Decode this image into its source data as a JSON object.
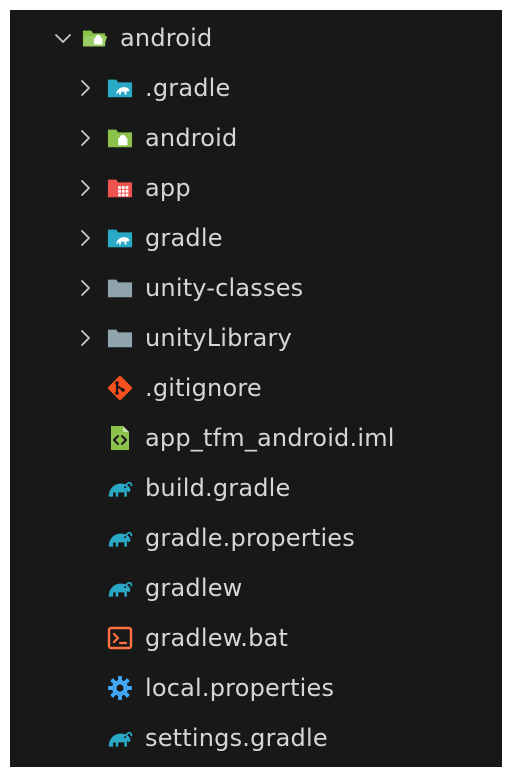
{
  "explorer": {
    "root": {
      "label": "android",
      "expanded": true,
      "icon": "android-folder-open-icon"
    },
    "items": [
      {
        "label": ".gradle",
        "type": "folder",
        "icon": "gradle-folder-icon"
      },
      {
        "label": "android",
        "type": "folder",
        "icon": "android-folder-icon"
      },
      {
        "label": "app",
        "type": "folder",
        "icon": "app-folder-icon"
      },
      {
        "label": "gradle",
        "type": "folder",
        "icon": "gradle-folder-icon"
      },
      {
        "label": "unity-classes",
        "type": "folder",
        "icon": "folder-icon"
      },
      {
        "label": "unityLibrary",
        "type": "folder",
        "icon": "folder-icon"
      },
      {
        "label": ".gitignore",
        "type": "file",
        "icon": "git-icon"
      },
      {
        "label": "app_tfm_android.iml",
        "type": "file",
        "icon": "xml-file-icon"
      },
      {
        "label": "build.gradle",
        "type": "file",
        "icon": "gradle-elephant-icon"
      },
      {
        "label": "gradle.properties",
        "type": "file",
        "icon": "gradle-elephant-icon"
      },
      {
        "label": "gradlew",
        "type": "file",
        "icon": "gradle-elephant-icon"
      },
      {
        "label": "gradlew.bat",
        "type": "file",
        "icon": "terminal-icon"
      },
      {
        "label": "local.properties",
        "type": "file",
        "icon": "settings-gear-icon"
      },
      {
        "label": "settings.gradle",
        "type": "file",
        "icon": "gradle-elephant-icon"
      }
    ]
  },
  "colors": {
    "background": "#181818",
    "text": "#d6d6d6",
    "android_green": "#8bc34a",
    "gradle_teal": "#2aa9c6",
    "app_red": "#ef5350",
    "folder_grey": "#90a4ae",
    "git_orange": "#f4511e",
    "xml_green": "#8bc34a",
    "terminal_orange": "#ff7043",
    "gear_blue": "#42a5f5"
  }
}
